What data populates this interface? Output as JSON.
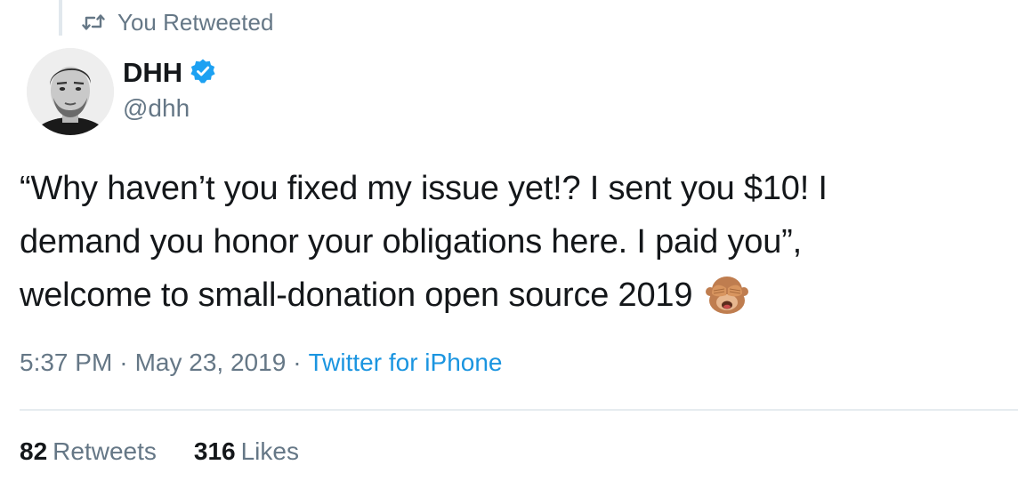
{
  "retweet_context": {
    "label": "You Retweeted",
    "icon": "retweet-icon"
  },
  "author": {
    "name": "DHH",
    "handle": "@dhh",
    "verified_icon": "verified-badge-icon",
    "avatar_icon": "profile-photo"
  },
  "tweet": {
    "text_lines": [
      "“Why haven’t you fixed my issue yet!? I sent you $10! I",
      "demand you honor your obligations here. I paid you”,",
      "welcome to small-donation open source 2019"
    ],
    "emoji_icon": "see-no-evil-monkey-icon"
  },
  "meta": {
    "time": "5:37 PM",
    "separator": "·",
    "date": "May 23, 2019",
    "source": "Twitter for iPhone"
  },
  "stats": {
    "retweets_count": "82",
    "retweets_label": "Retweets",
    "likes_count": "316",
    "likes_label": "Likes"
  },
  "colors": {
    "text": "#14171a",
    "secondary": "#657786",
    "accent": "#1b95e0",
    "divider": "#e6ecf0"
  }
}
